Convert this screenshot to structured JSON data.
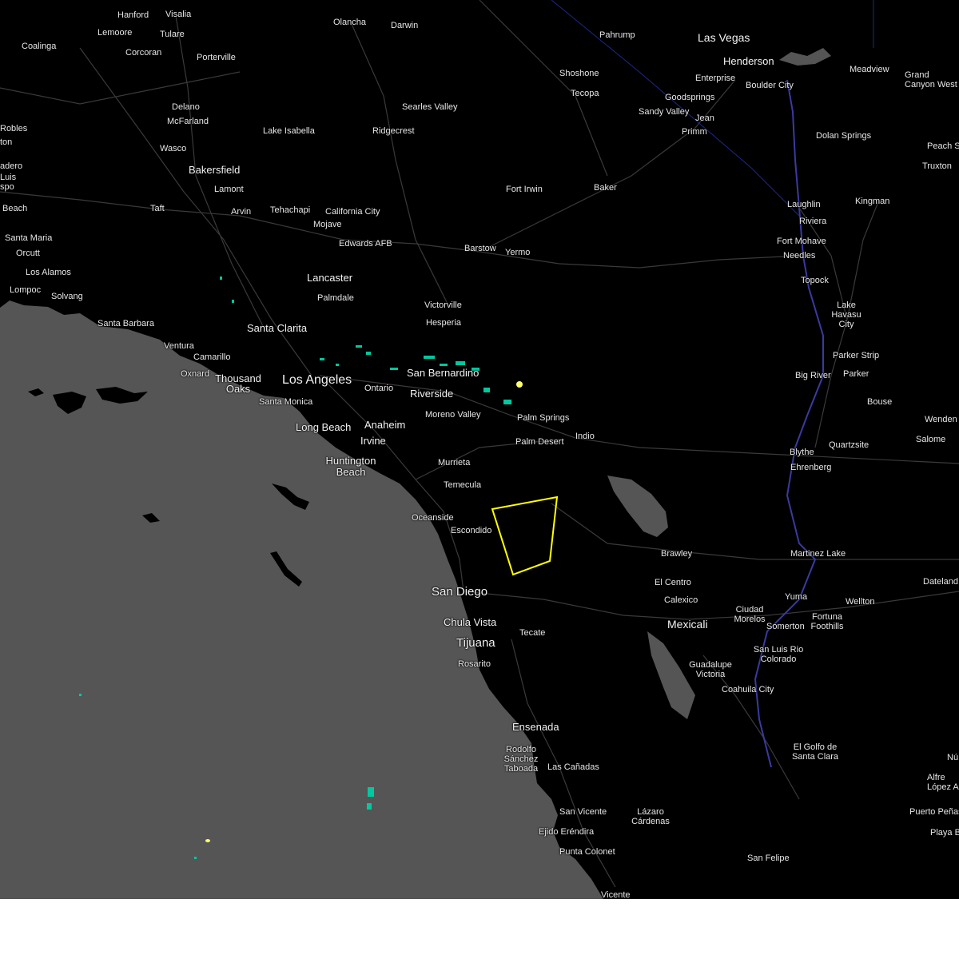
{
  "map": {
    "colors": {
      "land": "#000000",
      "ocean": "#555555",
      "roads": "#3a3a3a",
      "warning_polygon": "#ffff00",
      "radar_light": "#00c8a0",
      "radar_strong": "#ffff66",
      "state_line": "#1a2a8a",
      "river": "#3a3aa0"
    },
    "cities": {
      "hanford": "Hanford",
      "visalia": "Visalia",
      "lemoore": "Lemoore",
      "tulare": "Tulare",
      "coalinga": "Coalinga",
      "corcoran": "Corcoran",
      "porterville": "Porterville",
      "olancha": "Olancha",
      "darwin": "Darwin",
      "pahrump": "Pahrump",
      "las_vegas": "Las Vegas",
      "henderson": "Henderson",
      "enterprise": "Enterprise",
      "boulder_city": "Boulder City",
      "meadview": "Meadview",
      "grand_canyon_west": "Grand Canyon West",
      "shoshone": "Shoshone",
      "tecopa": "Tecopa",
      "goodsprings": "Goodsprings",
      "sandy_valley": "Sandy Valley",
      "jean": "Jean",
      "primm": "Primm",
      "delano": "Delano",
      "mcfarland": "McFarland",
      "searles_valley": "Searles Valley",
      "robles": "Robles",
      "ton": "ton",
      "lake_isabella": "Lake Isabella",
      "ridgecrest": "Ridgecrest",
      "wasco": "Wasco",
      "dolan_springs": "Dolan Springs",
      "peach_s": "Peach S",
      "truxton": "Truxton",
      "adero": "adero",
      "luis": "Luis",
      "spo": "spo",
      "bakersfield": "Bakersfield",
      "lamont": "Lamont",
      "arvin": "Arvin",
      "fort_irwin": "Fort Irwin",
      "baker": "Baker",
      "beach_w": "Beach",
      "taft": "Taft",
      "tehachapi": "Tehachapi",
      "california_city": "California City",
      "mojave": "Mojave",
      "laughlin": "Laughlin",
      "kingman": "Kingman",
      "riviera": "Riviera",
      "santa_maria": "Santa Maria",
      "edwards_afb": "Edwards AFB",
      "barstow": "Barstow",
      "yermo": "Yermo",
      "fort_mohave": "Fort Mohave",
      "orcutt": "Orcutt",
      "needles": "Needles",
      "los_alamos": "Los Alamos",
      "lancaster": "Lancaster",
      "topock": "Topock",
      "lompoc": "Lompoc",
      "solvang": "Solvang",
      "palmdale": "Palmdale",
      "victorville": "Victorville",
      "lake_havasu_city": "Lake Havasu City",
      "santa_barbara": "Santa Barbara",
      "hesperia": "Hesperia",
      "santa_clarita": "Santa Clarita",
      "ventura": "Ventura",
      "camarillo": "Camarillo",
      "parker_strip": "Parker Strip",
      "oxnard": "Oxnard",
      "thousand_oaks": "Thousand Oaks",
      "san_bernardino": "San Bernardino",
      "los_angeles": "Los Angeles",
      "big_river": "Big River",
      "parker": "Parker",
      "ontario": "Ontario",
      "riverside": "Riverside",
      "santa_monica": "Santa Monica",
      "bouse": "Bouse",
      "palm_springs": "Palm Springs",
      "moreno_valley": "Moreno Valley",
      "anaheim": "Anaheim",
      "long_beach": "Long Beach",
      "wenden": "Wenden",
      "irvine": "Irvine",
      "indio": "Indio",
      "palm_desert": "Palm Desert",
      "salome": "Salome",
      "blythe": "Blythe",
      "quartzsite": "Quartzsite",
      "huntington_beach": "Huntington Beach",
      "murrieta": "Murrieta",
      "ehrenberg": "Ehrenberg",
      "temecula": "Temecula",
      "oceanside": "Oceanside",
      "escondido": "Escondido",
      "brawley": "Brawley",
      "martinez_lake": "Martinez Lake",
      "el_centro": "El Centro",
      "dateland": "Dateland",
      "san_diego": "San Diego",
      "yuma": "Yuma",
      "wellton": "Wellton",
      "calexico": "Calexico",
      "ciudad_morelos": "Ciudad Morelos",
      "fortuna_foothills": "Fortuna Foothills",
      "chula_vista": "Chula Vista",
      "mexicali": "Mexicali",
      "somerton": "Somerton",
      "tecate": "Tecate",
      "tijuana": "Tijuana",
      "san_luis_rio_colorado": "San Luis Rio Colorado",
      "rosarito": "Rosarito",
      "guadalupe_victoria": "Guadalupe Victoria",
      "coahuila_city": "Coahuila City",
      "ensenada": "Ensenada",
      "el_golfo_de_santa_clara": "El Golfo de Santa Clara",
      "nu": "Nú",
      "rodolfo_sanchez_taboada": "Rodolfo Sánchez Taboada",
      "las_canadas": "Las Cañadas",
      "alfredo_lopez_a": "Alfre López A",
      "san_vicente": "San Vicente",
      "lazaro_cardenas": "Lázaro Cárdenas",
      "puerto_penasco": "Puerto Peñas",
      "ejido_erendira": "Ejido Eréndira",
      "playa_b": "Playa B",
      "punta_colonet": "Punta Colonet",
      "san_felipe": "San Felipe",
      "vicente": "Vicente"
    }
  }
}
